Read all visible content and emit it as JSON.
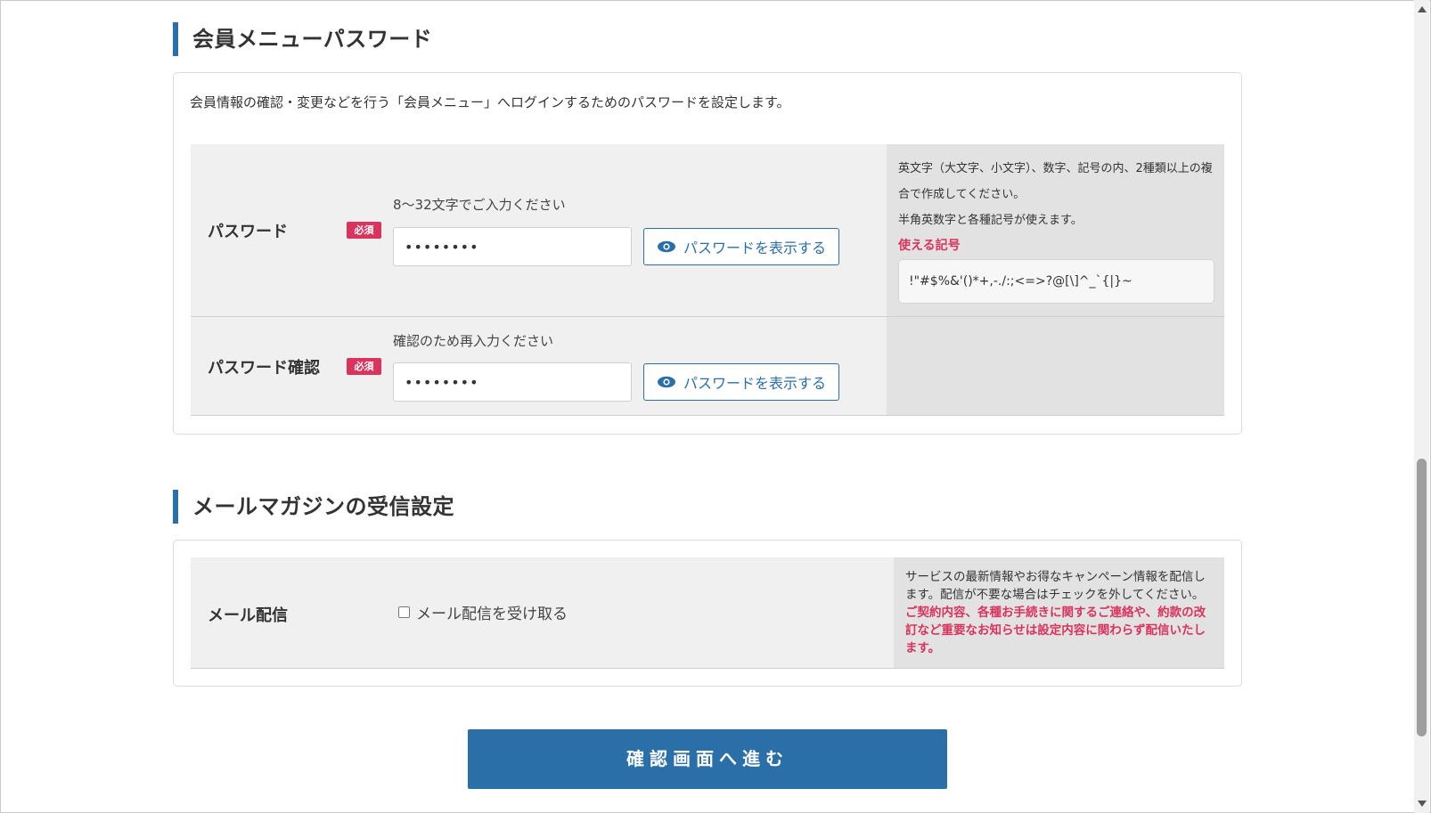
{
  "password_section": {
    "title": "会員メニューパスワード",
    "intro": "会員情報の確認・変更などを行う「会員メニュー」へログインするためのパスワードを設定します。",
    "password": {
      "label": "パスワード",
      "required_badge": "必須",
      "hint": "8～32文字でご入力ください",
      "value": "••••••••",
      "show_button": "パスワードを表示する"
    },
    "password_confirm": {
      "label": "パスワード確認",
      "required_badge": "必須",
      "hint": "確認のため再入力ください",
      "value": "••••••••",
      "show_button": "パスワードを表示する"
    },
    "rules": {
      "line1": "英文字（大文字、小文字）、数字、記号の内、2種類以上の複",
      "line2": "合で作成してください。",
      "line3": "半角英数字と各種記号が使えます。",
      "symbols_heading": "使える記号",
      "symbols": "!\"#$%&'()*+,-./:;<=>?@[\\]^_`{|}~"
    }
  },
  "newsletter_section": {
    "title": "メールマガジンの受信設定",
    "label": "メール配信",
    "checkbox_label": "メール配信を受け取る",
    "checked": false,
    "note_normal": "サービスの最新情報やお得なキャンペーン情報を配信します。配信が不要な場合はチェックを外してください。",
    "note_red": "ご契約内容、各種お手続きに関するご連絡や、約款の改訂など重要なお知らせは設定内容に関わらず配信いたします。"
  },
  "submit_button": "確認画面へ進む",
  "colors": {
    "accent": "#2a6fa8",
    "required": "#d9335e"
  }
}
